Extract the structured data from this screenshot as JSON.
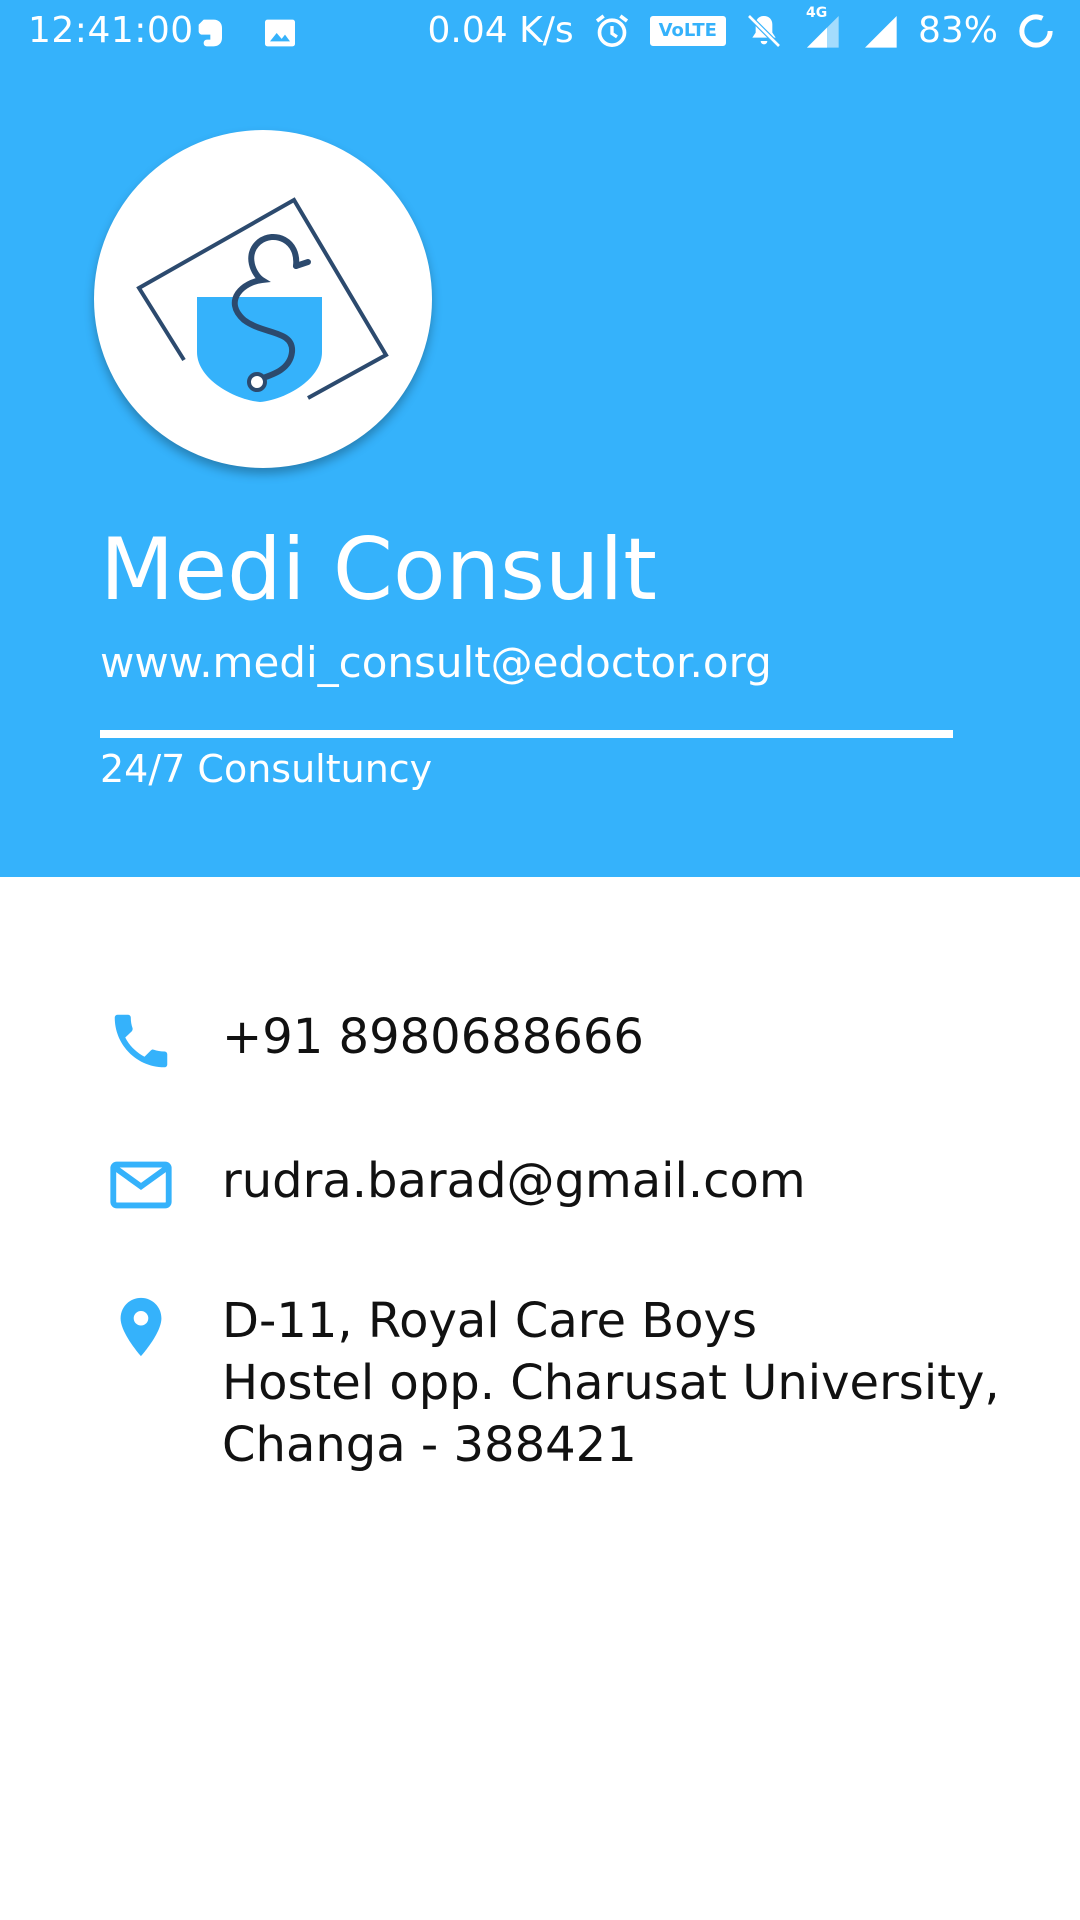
{
  "status_bar": {
    "time": "12:41:00",
    "net_speed": "0.04 K/s",
    "volte": "VoLTE",
    "network": "4G",
    "battery": "83%",
    "icons": [
      "evernote-icon",
      "image-icon",
      "alarm-icon",
      "volte-icon",
      "mute-bell-icon",
      "signal-4g-icon",
      "signal-icon",
      "battery-icon"
    ]
  },
  "header": {
    "background_color": "#35B2FB",
    "logo_icon": "stethoscope-pocket-logo",
    "title": "Medi Consult",
    "website": "www.medi_consult@edoctor.org",
    "tagline": "24/7 Consultuncy"
  },
  "contacts": [
    {
      "icon": "phone-icon",
      "text": "+91 8980688666"
    },
    {
      "icon": "mail-icon",
      "text": "rudra.barad@gmail.com"
    },
    {
      "icon": "location-pin-icon",
      "lines": [
        "D-11, Royal Care Boys",
        "Hostel opp. Charusat University,",
        "Changa - 388421"
      ]
    }
  ],
  "accent_color": "#35B2FB"
}
